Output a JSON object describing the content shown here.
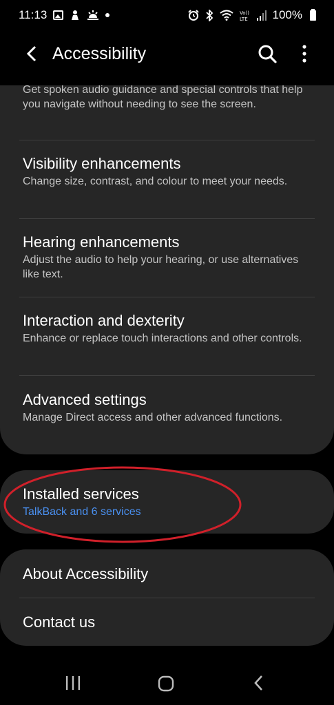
{
  "status_bar": {
    "time": "11:13",
    "battery": "100%",
    "left_icons": [
      "gallery-icon",
      "person-icon",
      "weather-icon",
      "dot-icon"
    ],
    "right_icons": [
      "alarm-icon",
      "bluetooth-icon",
      "wifi-icon",
      "volte-icon",
      "signal-icon",
      "battery-icon"
    ]
  },
  "app_bar": {
    "title": "Accessibility"
  },
  "main_list": {
    "partial_item": {
      "subtitle": "Get spoken audio guidance and special controls that help you navigate without needing to see the screen."
    },
    "items": [
      {
        "title": "Visibility enhancements",
        "subtitle": "Change size, contrast, and colour to meet your needs."
      },
      {
        "title": "Hearing enhancements",
        "subtitle": "Adjust the audio to help your hearing, or use alternatives like text."
      },
      {
        "title": "Interaction and dexterity",
        "subtitle": "Enhance or replace touch interactions and other controls."
      },
      {
        "title": "Advanced settings",
        "subtitle": "Manage Direct access and other advanced functions."
      }
    ]
  },
  "installed_services": {
    "title": "Installed services",
    "subtitle": "TalkBack and 6 services"
  },
  "footer_list": {
    "items": [
      "About Accessibility",
      "Contact us"
    ]
  },
  "colors": {
    "background": "#000000",
    "card": "#262626",
    "link": "#4a90f0",
    "highlight": "#d0202a"
  }
}
